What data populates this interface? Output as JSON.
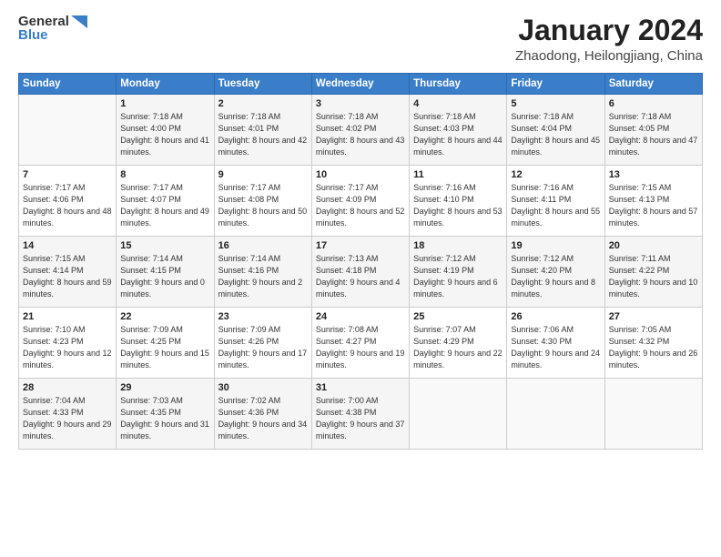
{
  "logo": {
    "general": "General",
    "blue": "Blue"
  },
  "title": "January 2024",
  "location": "Zhaodong, Heilongjiang, China",
  "headers": [
    "Sunday",
    "Monday",
    "Tuesday",
    "Wednesday",
    "Thursday",
    "Friday",
    "Saturday"
  ],
  "weeks": [
    [
      {
        "day": "",
        "sunrise": "",
        "sunset": "",
        "daylight": ""
      },
      {
        "day": "1",
        "sunrise": "Sunrise: 7:18 AM",
        "sunset": "Sunset: 4:00 PM",
        "daylight": "Daylight: 8 hours and 41 minutes."
      },
      {
        "day": "2",
        "sunrise": "Sunrise: 7:18 AM",
        "sunset": "Sunset: 4:01 PM",
        "daylight": "Daylight: 8 hours and 42 minutes."
      },
      {
        "day": "3",
        "sunrise": "Sunrise: 7:18 AM",
        "sunset": "Sunset: 4:02 PM",
        "daylight": "Daylight: 8 hours and 43 minutes."
      },
      {
        "day": "4",
        "sunrise": "Sunrise: 7:18 AM",
        "sunset": "Sunset: 4:03 PM",
        "daylight": "Daylight: 8 hours and 44 minutes."
      },
      {
        "day": "5",
        "sunrise": "Sunrise: 7:18 AM",
        "sunset": "Sunset: 4:04 PM",
        "daylight": "Daylight: 8 hours and 45 minutes."
      },
      {
        "day": "6",
        "sunrise": "Sunrise: 7:18 AM",
        "sunset": "Sunset: 4:05 PM",
        "daylight": "Daylight: 8 hours and 47 minutes."
      }
    ],
    [
      {
        "day": "7",
        "sunrise": "Sunrise: 7:17 AM",
        "sunset": "Sunset: 4:06 PM",
        "daylight": "Daylight: 8 hours and 48 minutes."
      },
      {
        "day": "8",
        "sunrise": "Sunrise: 7:17 AM",
        "sunset": "Sunset: 4:07 PM",
        "daylight": "Daylight: 8 hours and 49 minutes."
      },
      {
        "day": "9",
        "sunrise": "Sunrise: 7:17 AM",
        "sunset": "Sunset: 4:08 PM",
        "daylight": "Daylight: 8 hours and 50 minutes."
      },
      {
        "day": "10",
        "sunrise": "Sunrise: 7:17 AM",
        "sunset": "Sunset: 4:09 PM",
        "daylight": "Daylight: 8 hours and 52 minutes."
      },
      {
        "day": "11",
        "sunrise": "Sunrise: 7:16 AM",
        "sunset": "Sunset: 4:10 PM",
        "daylight": "Daylight: 8 hours and 53 minutes."
      },
      {
        "day": "12",
        "sunrise": "Sunrise: 7:16 AM",
        "sunset": "Sunset: 4:11 PM",
        "daylight": "Daylight: 8 hours and 55 minutes."
      },
      {
        "day": "13",
        "sunrise": "Sunrise: 7:15 AM",
        "sunset": "Sunset: 4:13 PM",
        "daylight": "Daylight: 8 hours and 57 minutes."
      }
    ],
    [
      {
        "day": "14",
        "sunrise": "Sunrise: 7:15 AM",
        "sunset": "Sunset: 4:14 PM",
        "daylight": "Daylight: 8 hours and 59 minutes."
      },
      {
        "day": "15",
        "sunrise": "Sunrise: 7:14 AM",
        "sunset": "Sunset: 4:15 PM",
        "daylight": "Daylight: 9 hours and 0 minutes."
      },
      {
        "day": "16",
        "sunrise": "Sunrise: 7:14 AM",
        "sunset": "Sunset: 4:16 PM",
        "daylight": "Daylight: 9 hours and 2 minutes."
      },
      {
        "day": "17",
        "sunrise": "Sunrise: 7:13 AM",
        "sunset": "Sunset: 4:18 PM",
        "daylight": "Daylight: 9 hours and 4 minutes."
      },
      {
        "day": "18",
        "sunrise": "Sunrise: 7:12 AM",
        "sunset": "Sunset: 4:19 PM",
        "daylight": "Daylight: 9 hours and 6 minutes."
      },
      {
        "day": "19",
        "sunrise": "Sunrise: 7:12 AM",
        "sunset": "Sunset: 4:20 PM",
        "daylight": "Daylight: 9 hours and 8 minutes."
      },
      {
        "day": "20",
        "sunrise": "Sunrise: 7:11 AM",
        "sunset": "Sunset: 4:22 PM",
        "daylight": "Daylight: 9 hours and 10 minutes."
      }
    ],
    [
      {
        "day": "21",
        "sunrise": "Sunrise: 7:10 AM",
        "sunset": "Sunset: 4:23 PM",
        "daylight": "Daylight: 9 hours and 12 minutes."
      },
      {
        "day": "22",
        "sunrise": "Sunrise: 7:09 AM",
        "sunset": "Sunset: 4:25 PM",
        "daylight": "Daylight: 9 hours and 15 minutes."
      },
      {
        "day": "23",
        "sunrise": "Sunrise: 7:09 AM",
        "sunset": "Sunset: 4:26 PM",
        "daylight": "Daylight: 9 hours and 17 minutes."
      },
      {
        "day": "24",
        "sunrise": "Sunrise: 7:08 AM",
        "sunset": "Sunset: 4:27 PM",
        "daylight": "Daylight: 9 hours and 19 minutes."
      },
      {
        "day": "25",
        "sunrise": "Sunrise: 7:07 AM",
        "sunset": "Sunset: 4:29 PM",
        "daylight": "Daylight: 9 hours and 22 minutes."
      },
      {
        "day": "26",
        "sunrise": "Sunrise: 7:06 AM",
        "sunset": "Sunset: 4:30 PM",
        "daylight": "Daylight: 9 hours and 24 minutes."
      },
      {
        "day": "27",
        "sunrise": "Sunrise: 7:05 AM",
        "sunset": "Sunset: 4:32 PM",
        "daylight": "Daylight: 9 hours and 26 minutes."
      }
    ],
    [
      {
        "day": "28",
        "sunrise": "Sunrise: 7:04 AM",
        "sunset": "Sunset: 4:33 PM",
        "daylight": "Daylight: 9 hours and 29 minutes."
      },
      {
        "day": "29",
        "sunrise": "Sunrise: 7:03 AM",
        "sunset": "Sunset: 4:35 PM",
        "daylight": "Daylight: 9 hours and 31 minutes."
      },
      {
        "day": "30",
        "sunrise": "Sunrise: 7:02 AM",
        "sunset": "Sunset: 4:36 PM",
        "daylight": "Daylight: 9 hours and 34 minutes."
      },
      {
        "day": "31",
        "sunrise": "Sunrise: 7:00 AM",
        "sunset": "Sunset: 4:38 PM",
        "daylight": "Daylight: 9 hours and 37 minutes."
      },
      {
        "day": "",
        "sunrise": "",
        "sunset": "",
        "daylight": ""
      },
      {
        "day": "",
        "sunrise": "",
        "sunset": "",
        "daylight": ""
      },
      {
        "day": "",
        "sunrise": "",
        "sunset": "",
        "daylight": ""
      }
    ]
  ]
}
